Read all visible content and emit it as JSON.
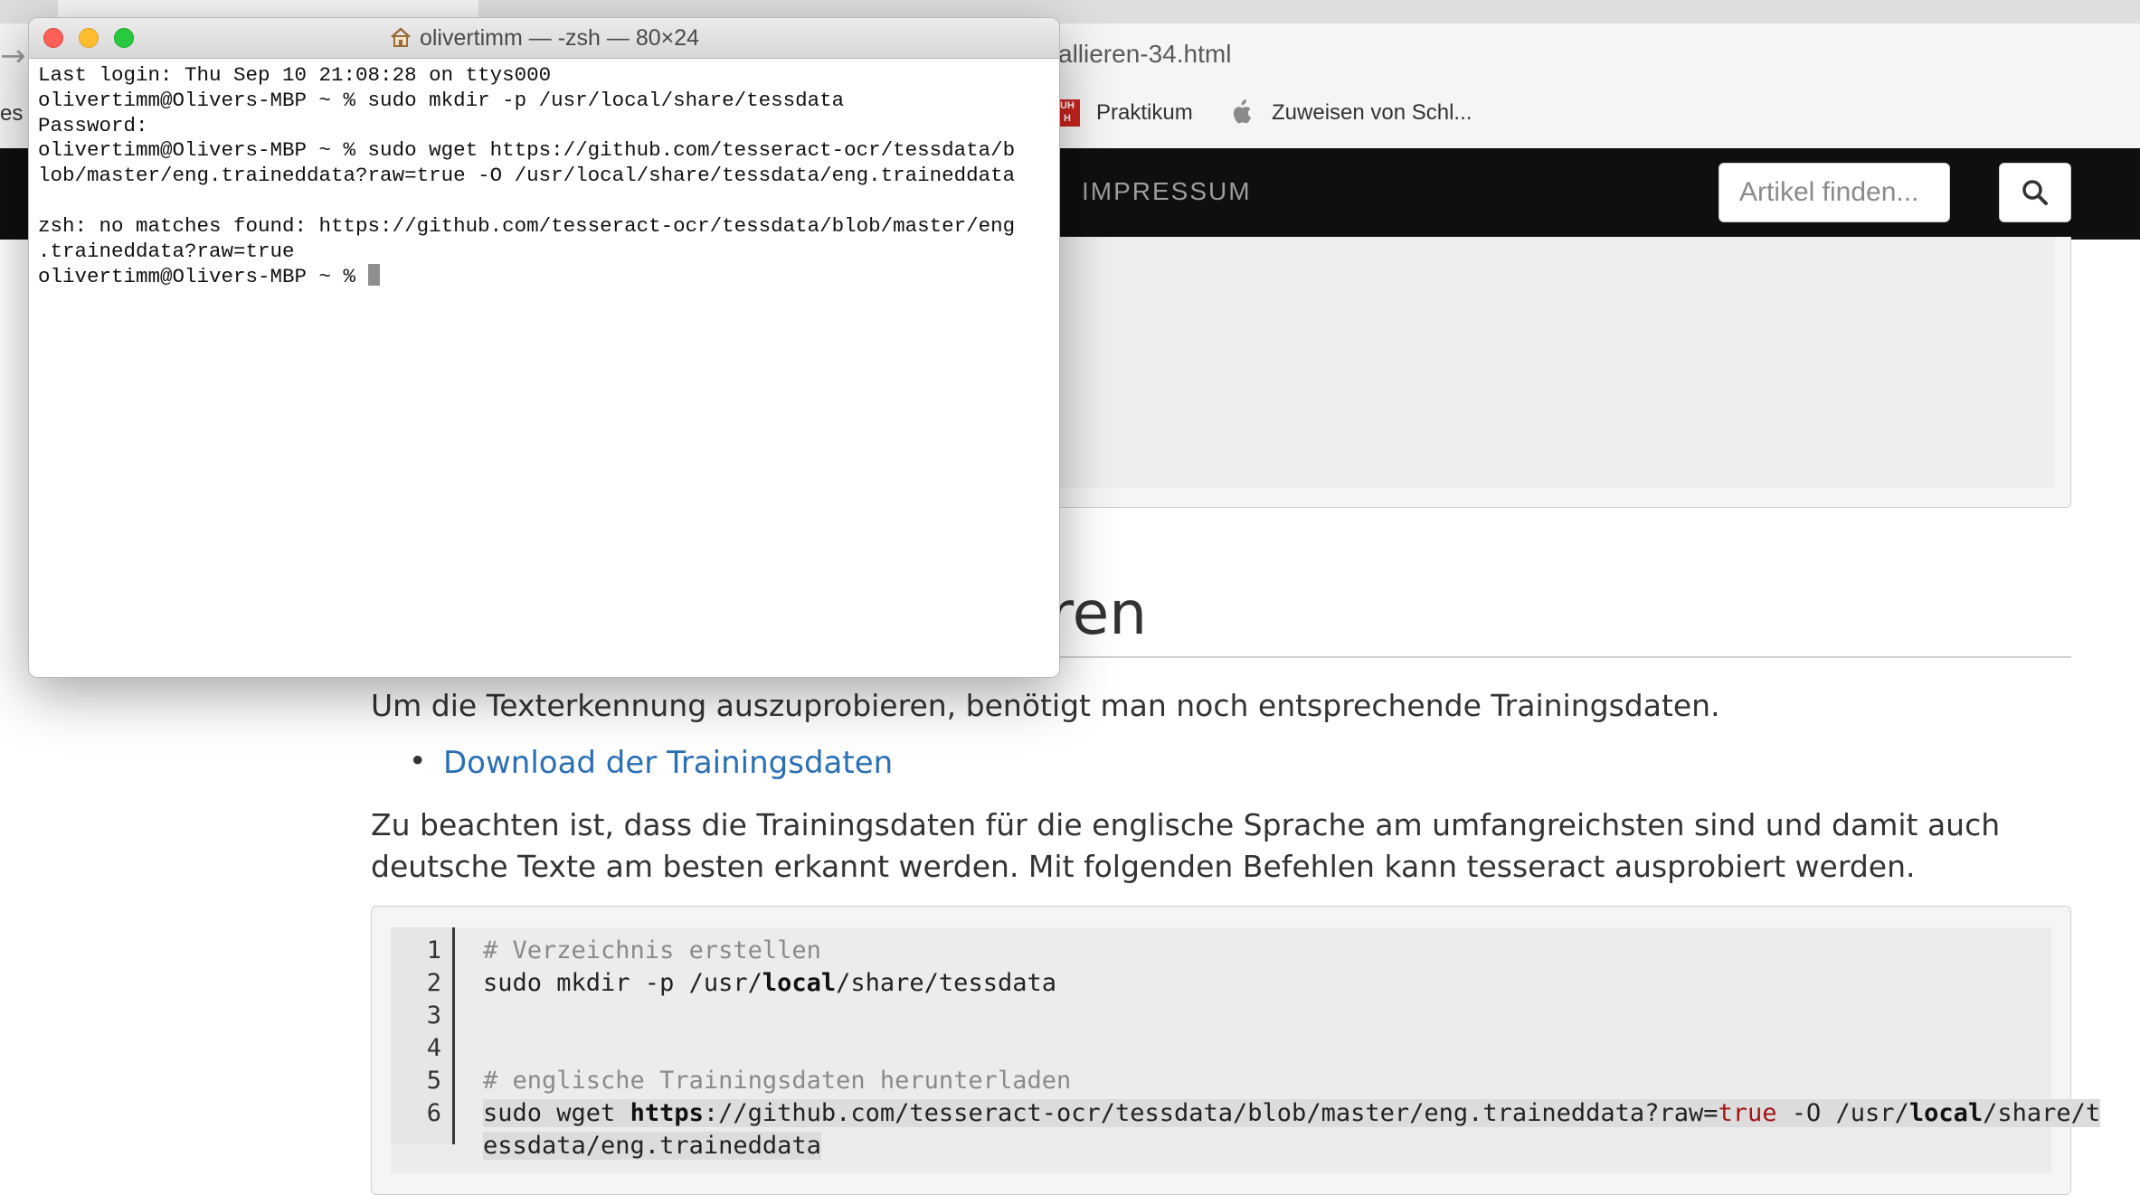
{
  "browser": {
    "url_fragment": "allieren-34.html",
    "bookmarks_left_partial": "es",
    "bookmarks": [
      {
        "label": "Praktikum",
        "icon": "uhh-logo-icon"
      },
      {
        "label": "Zuweisen von Schl...",
        "icon": "apple-icon"
      }
    ]
  },
  "site": {
    "nav": {
      "impressum": "IMPRESSUM"
    },
    "search": {
      "placeholder": "Artikel finden..."
    },
    "heading_partial": "ren",
    "paragraph1": "Um die Texterkennung auszuprobieren, benötigt man noch entsprechende Trainingsdaten.",
    "download_link": "Download der Trainingsdaten",
    "paragraph2_line1": "Zu beachten ist, dass die Trainingsdaten für die englische Sprache am umfangreichsten sind und damit auch",
    "paragraph2_line2": "deutsche Texte am besten erkannt werden. Mit folgenden Befehlen kann tesseract ausprobiert werden.",
    "code": {
      "line_numbers": [
        "1",
        "2",
        "3",
        "4",
        "5",
        "6"
      ],
      "line1": "# Verzeichnis erstellen",
      "line2_a": "sudo mkdir -p /usr/",
      "line2_kw": "local",
      "line2_b": "/share/tessdata",
      "line5": "# englische Trainingsdaten herunterladen",
      "line6_a": "sudo wget ",
      "line6_kw1": "https",
      "line6_b": "://github.com/tesseract-ocr/tessdata/blob/master/eng.traineddata?raw=",
      "line6_lit": "true",
      "line6_c": " -O /usr/",
      "line6_kw2": "local",
      "line6_d": "/share/t",
      "line6_wrap": "essdata/eng.traineddata"
    }
  },
  "terminal": {
    "title": "olivertimm — -zsh — 80×24",
    "lines": [
      "Last login: Thu Sep 10 21:08:28 on ttys000",
      "olivertimm@Olivers-MBP ~ % sudo mkdir -p /usr/local/share/tessdata",
      "Password:",
      "olivertimm@Olivers-MBP ~ % sudo wget https://github.com/tesseract-ocr/tessdata/b",
      "lob/master/eng.traineddata?raw=true -O /usr/local/share/tessdata/eng.traineddata",
      "",
      "zsh: no matches found: https://github.com/tesseract-ocr/tessdata/blob/master/eng",
      ".traineddata?raw=true"
    ],
    "prompt": "olivertimm@Olivers-MBP ~ % "
  }
}
